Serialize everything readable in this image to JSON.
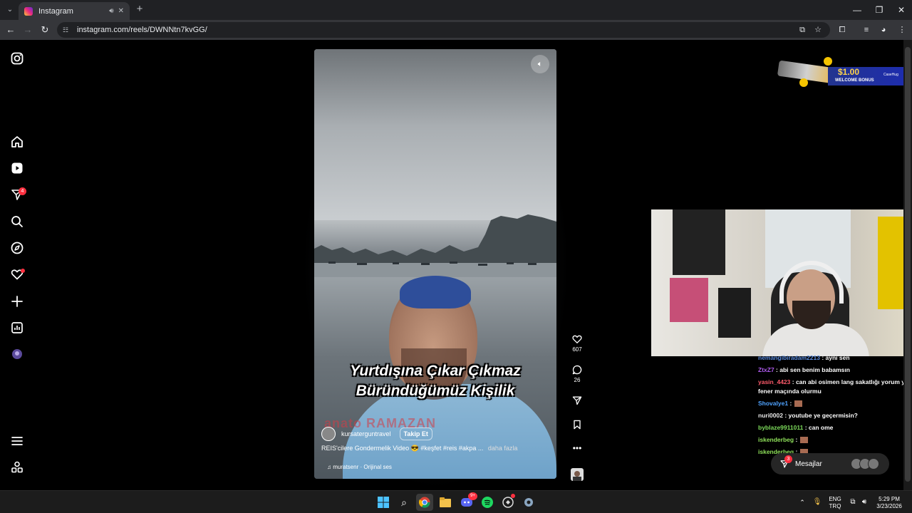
{
  "browser": {
    "tab_title": "Instagram",
    "url": "instagram.com/reels/DWNNtn7kvGG/"
  },
  "sidebar": {
    "notifications_badge": "4"
  },
  "reel": {
    "caption_line1": "Yurtdışına Çıkar Çıkmaz",
    "caption_line2": "Büründüğümüz Kişilik",
    "overlay_text": "anato RAMAZAN",
    "username": "kursaterguntravel",
    "follow_label": "Takip Et",
    "description": "REIS'cilere Gondermelik Video 😎 #keşfet #reis #akpa ...",
    "more_label": "daha fazla",
    "audio": "muratsenr · Orijinal ses",
    "likes": "607",
    "comments": "26"
  },
  "ad": {
    "price": "$1.00",
    "subtitle": "WELCOME BONUS",
    "brand": "CaseHug"
  },
  "chat": {
    "messages": [
      {
        "user": "nemangibiradam2213",
        "text": ": aynı sen",
        "color": "#5b8de0"
      },
      {
        "user": "ZtxZ7",
        "text": ": abi sen benim babamsın",
        "color": "#b05cf0"
      },
      {
        "user": "yasin_4423",
        "text": ": can abi osimen lang sakatlığı yorum yap fener maçında olurmu",
        "color": "#ff5b6b"
      },
      {
        "user": "Shovalye1",
        "text": ":",
        "color": "#4fa3ff",
        "emote": true
      },
      {
        "user": "nuri0002",
        "text": ": youtube ye geçermisin?",
        "color": "#e8e8e8"
      },
      {
        "user": "byblaze9911011",
        "text": ": can ome",
        "color": "#7ddc5b"
      },
      {
        "user": "iskenderbeg",
        "text": ":",
        "color": "#8fe15a",
        "emote": true
      },
      {
        "user": "iskenderbeg",
        "text": ":",
        "color": "#8fe15a",
        "emote": true
      }
    ]
  },
  "messages_button": {
    "label": "Mesajlar",
    "badge": "3"
  },
  "taskbar": {
    "lang1": "ENG",
    "lang2": "TRQ",
    "time": "5:29 PM",
    "date": "3/23/2026",
    "discord_badge": "9+"
  }
}
